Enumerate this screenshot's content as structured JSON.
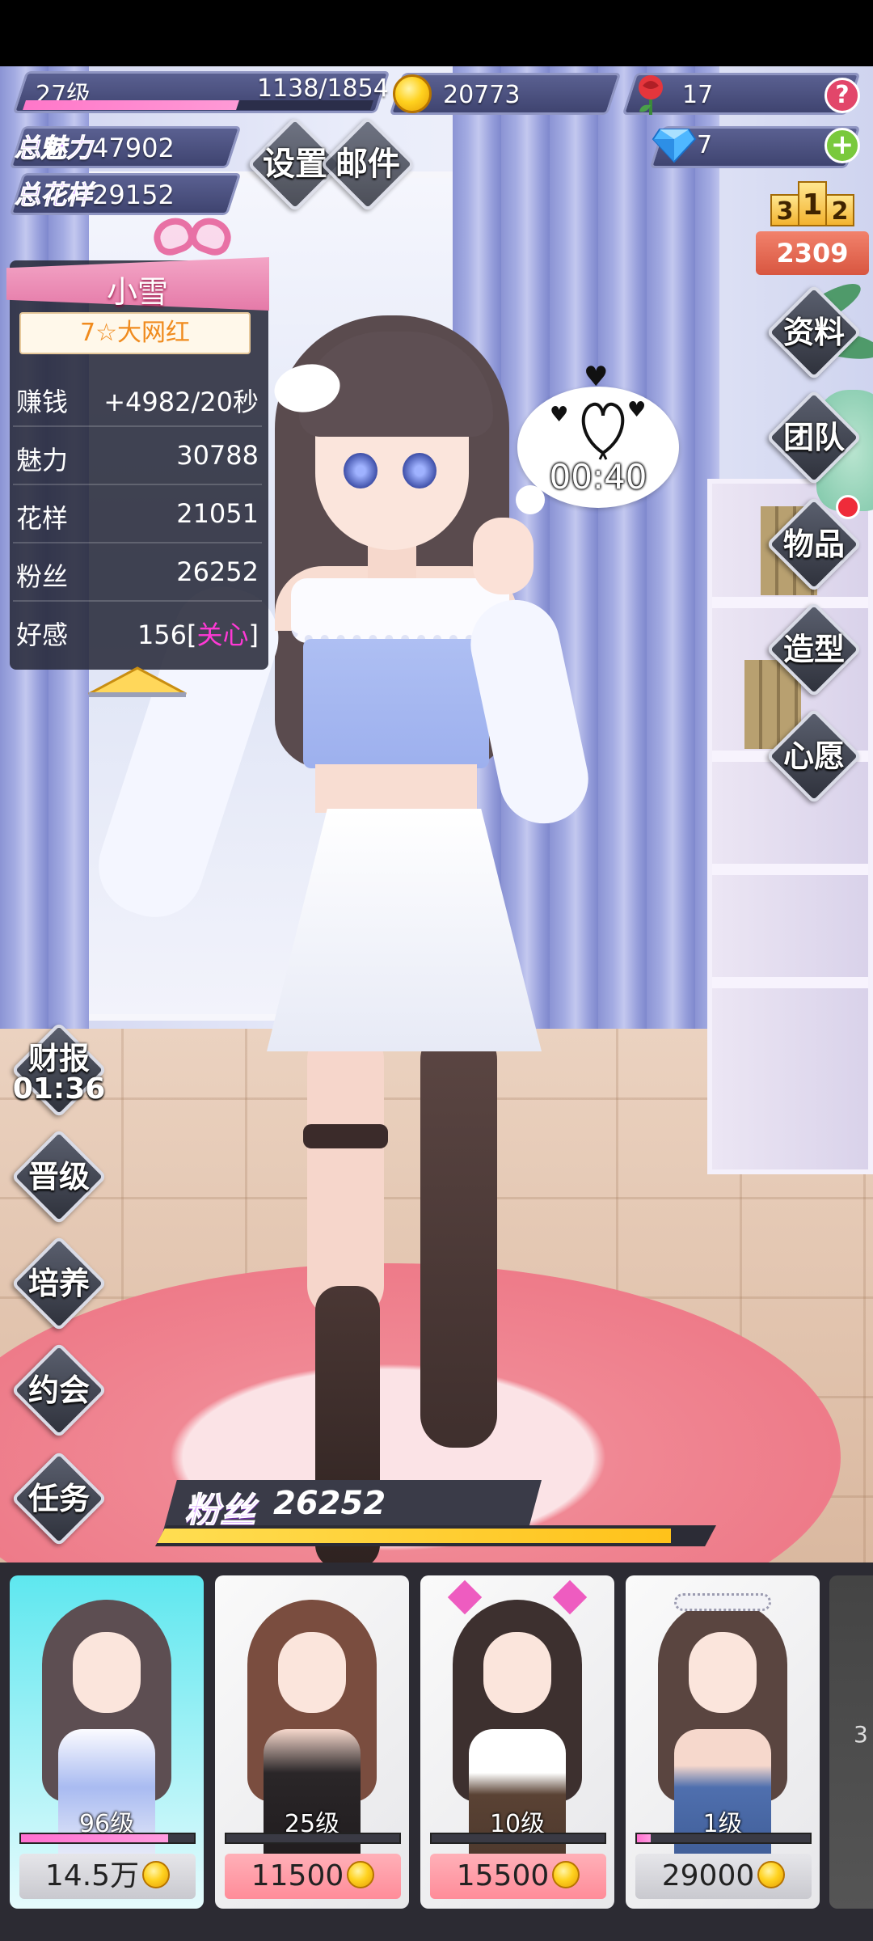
{
  "hud": {
    "level": "27级",
    "xp": "1138/1854",
    "xp_fraction": 0.614,
    "coins": "20773",
    "roses": "17",
    "diamonds": "7",
    "total_charm_label": "总魅力",
    "total_charm_value": "47902",
    "total_style_label": "总花样",
    "total_style_value": "29152",
    "settings": "设置",
    "mail": "邮件",
    "help": "?",
    "add": "+"
  },
  "ranking": {
    "places": [
      "3",
      "1",
      "2"
    ],
    "value": "2309"
  },
  "right_menu": [
    "资料",
    "团队",
    "物品",
    "造型",
    "心愿"
  ],
  "left_menu": {
    "report_label": "财报",
    "report_timer": "01:36",
    "items": [
      "晋级",
      "培养",
      "约会",
      "任务"
    ]
  },
  "character": {
    "name": "小雪",
    "title": "7☆大网红",
    "stats": [
      {
        "key": "赚钱",
        "value": "+4982/20秒"
      },
      {
        "key": "魅力",
        "value": "30788"
      },
      {
        "key": "花样",
        "value": "21051"
      },
      {
        "key": "粉丝",
        "value": "26252"
      },
      {
        "key": "好感",
        "value": "156",
        "tag": "关心"
      }
    ]
  },
  "bubble": {
    "timer": "00:40",
    "hearts": [
      "♥",
      "♥",
      "♥"
    ]
  },
  "fans_bar": {
    "label": "粉丝",
    "value": "26252",
    "fill_fraction": 0.92
  },
  "cards": [
    {
      "level": "96级",
      "price": "14.5万",
      "progress": 0.85,
      "selected": true,
      "price_style": "gray"
    },
    {
      "level": "25级",
      "price": "11500",
      "progress": 0.0,
      "selected": false,
      "price_style": "pink"
    },
    {
      "level": "10级",
      "price": "15500",
      "progress": 0.0,
      "selected": false,
      "price_style": "pink"
    },
    {
      "level": "1级",
      "price": "29000",
      "progress": 0.08,
      "selected": false,
      "price_style": "gray"
    }
  ],
  "peek_card_label": "3"
}
